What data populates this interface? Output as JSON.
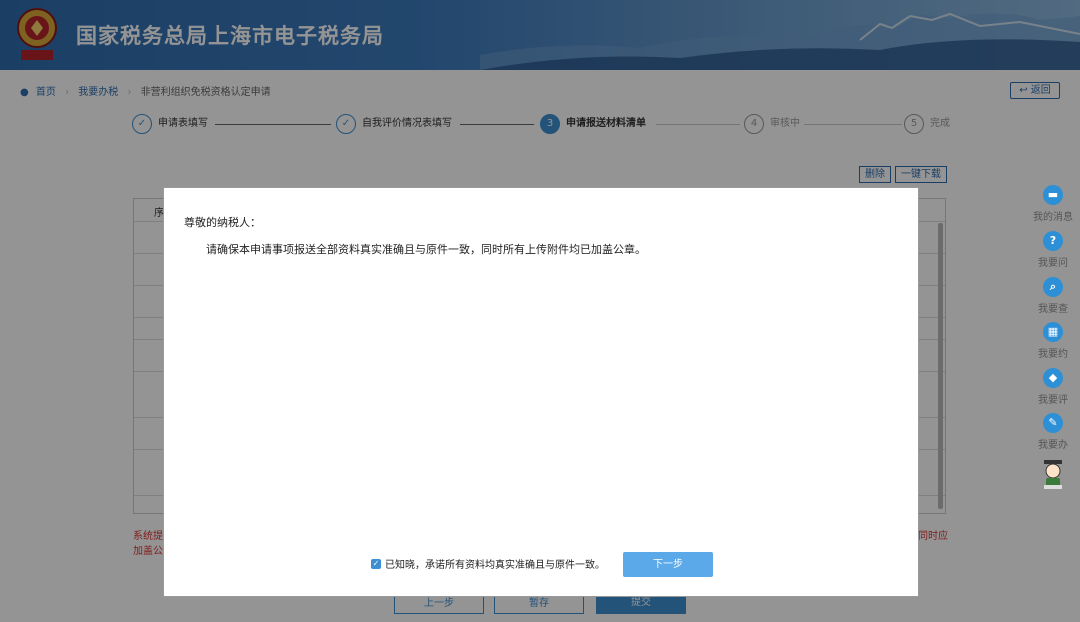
{
  "header": {
    "title": "国家税务总局上海市电子税务局",
    "emblem_icon": "tax-emblem-icon"
  },
  "breadcrumb": {
    "items": [
      "首页",
      "我要办税",
      "非营利组织免税资格认定申请"
    ],
    "back_label": "返回"
  },
  "steps": [
    {
      "number": "✓",
      "label": "申请表填写",
      "status": "done"
    },
    {
      "number": "✓",
      "label": "自我评价情况表填写",
      "status": "done"
    },
    {
      "number": "3",
      "label": "申请报送材料清单",
      "status": "active"
    },
    {
      "number": "4",
      "label": "审核中",
      "status": "pending"
    },
    {
      "number": "5",
      "label": "完成",
      "status": "pending"
    }
  ],
  "toolbar": {
    "delete_label": "删除",
    "download_label": "一键下载"
  },
  "background": {
    "table_header_partial": "序",
    "note_left_1": "系统提",
    "note_left_2": "加盖公",
    "note_right": "同时应",
    "btn_prev": "上一步",
    "btn_save": "暂存",
    "btn_submit": "提交"
  },
  "sidebar": {
    "items": [
      {
        "label": "我的消息",
        "icon": "message-icon"
      },
      {
        "label": "我要问",
        "icon": "question-icon"
      },
      {
        "label": "我要查",
        "icon": "search-icon"
      },
      {
        "label": "我要约",
        "icon": "calendar-icon"
      },
      {
        "label": "我要评",
        "icon": "rate-icon"
      },
      {
        "label": "我要办",
        "icon": "edit-icon"
      }
    ],
    "assistant_icon": "assistant-avatar-icon"
  },
  "modal": {
    "salutation": "尊敬的纳税人：",
    "body": "请确保本申请事项报送全部资料真实准确且与原件一致，同时所有上传附件均已加盖公章。",
    "confirm_label": "已知晓，承诺所有资料均真实准确且与原件一致。",
    "confirm_checked": true,
    "next_label": "下一步"
  },
  "colors": {
    "accent": "#3d8fd1",
    "header": "#2f6cae",
    "button": "#5ba9e8",
    "warning": "#dd3333"
  }
}
